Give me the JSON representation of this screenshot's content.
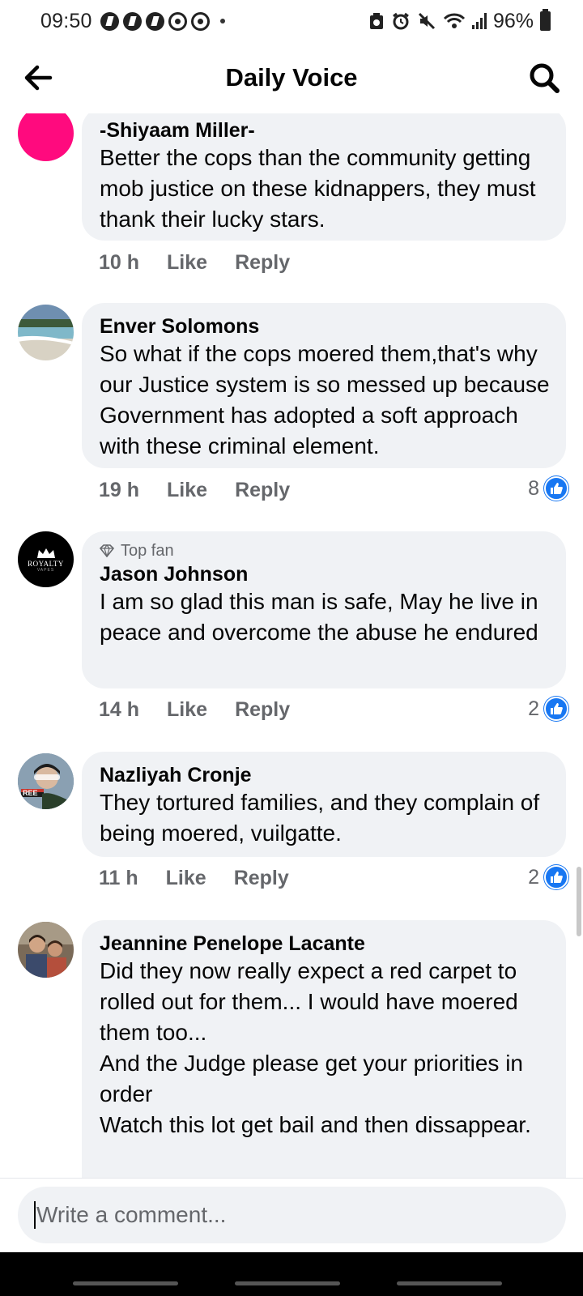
{
  "status_bar": {
    "time": "09:50",
    "battery": "96%",
    "notification_icons": [
      "app-icon",
      "app-icon",
      "app-icon",
      "app-outline-icon",
      "app-outline-icon"
    ],
    "right_icons": [
      "screenshot-icon",
      "alarm-icon",
      "mute-icon",
      "wifi-icon",
      "signal-icon",
      "battery-icon"
    ]
  },
  "header": {
    "title": "Daily Voice",
    "back_icon": "arrow-left-icon",
    "search_icon": "search-icon"
  },
  "comments": [
    {
      "author": "-Shiyaam Miller-",
      "text": "Better the cops than the community getting mob justice on these kidnappers, they must thank their lucky stars.",
      "time": "10 h",
      "like": "Like",
      "reply": "Reply",
      "reactions": "",
      "avatar_color": "#ff0a7e"
    },
    {
      "author": "Enver Solomons",
      "text": "So what if the cops moered them,that's why our Justice system is so messed up because Government has adopted a soft approach with these criminal element.",
      "time": "19 h",
      "like": "Like",
      "reply": "Reply",
      "reactions": "8"
    },
    {
      "badge": "Top fan",
      "author": "Jason Johnson",
      "text": "I am so glad this man is safe, May he live in peace and overcome the abuse he endured",
      "time": "14 h",
      "like": "Like",
      "reply": "Reply",
      "reactions": "2",
      "avatar_label": "ROYALTY",
      "avatar_sub": "VAPES"
    },
    {
      "author": "Nazliyah Cronje",
      "text": "They tortured families, and they complain of being moered, vuilgatte.",
      "time": "11 h",
      "like": "Like",
      "reply": "Reply",
      "reactions": "2",
      "avatar_label": "REE"
    },
    {
      "author": "Jeannine Penelope Lacante",
      "text": "Did they now really expect a red carpet to rolled out for them... I would have moered them too...\nAnd the Judge please get your priorities in order\nWatch this lot get bail and then dissappear."
    }
  ],
  "composer": {
    "placeholder": "Write a comment..."
  },
  "colors": {
    "accent": "#1877f2",
    "bubble": "#f0f2f5",
    "secondary_text": "#65676b"
  }
}
